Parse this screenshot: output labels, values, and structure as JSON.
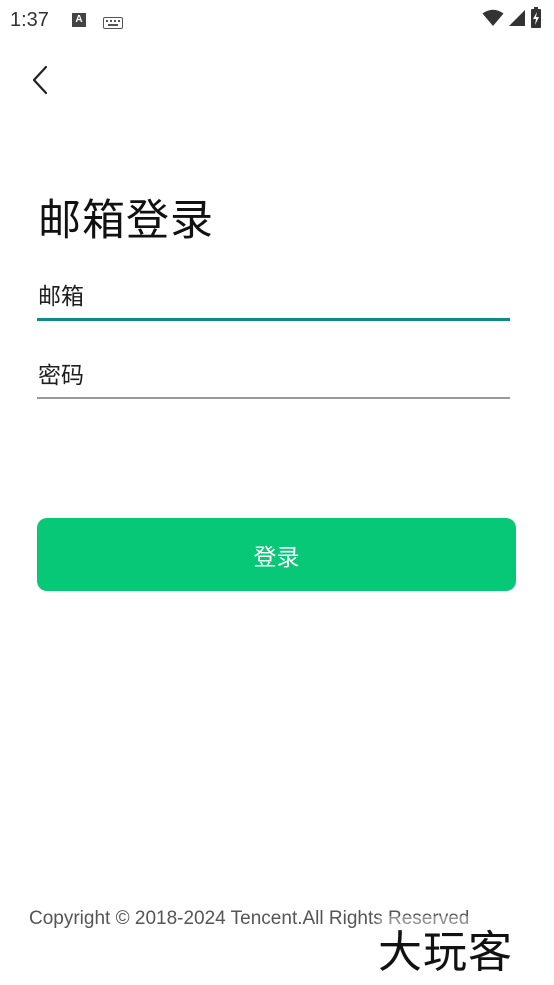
{
  "status_bar": {
    "time": "1:37",
    "icons": [
      "a-notification-icon",
      "keyboard-icon",
      "wifi-icon",
      "signal-icon",
      "battery-icon"
    ]
  },
  "nav": {
    "back_icon": "chevron-left-icon"
  },
  "login": {
    "title": "邮箱登录",
    "email_placeholder": "邮箱",
    "password_placeholder": "密码",
    "submit_label": "登录"
  },
  "footer": {
    "copyright": "Copyright © 2018-2024 Tencent.All Rights Reserved",
    "watermark": "大玩客"
  },
  "colors": {
    "accent_green": "#07c877",
    "focus_underline": "#0f8a86",
    "idle_underline": "#9a9a9a"
  }
}
